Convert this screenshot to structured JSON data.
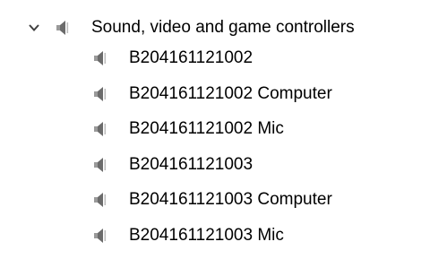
{
  "category": {
    "label": "Sound, video and game controllers",
    "expanded": true,
    "icon": "speaker-icon",
    "expand_icon": "chevron-down-icon"
  },
  "devices": [
    {
      "label": "B204161121002",
      "icon": "speaker-icon"
    },
    {
      "label": "B204161121002 Computer",
      "icon": "speaker-icon"
    },
    {
      "label": "B204161121002 Mic",
      "icon": "speaker-icon"
    },
    {
      "label": "B204161121003",
      "icon": "speaker-icon"
    },
    {
      "label": "B204161121003 Computer",
      "icon": "speaker-icon"
    },
    {
      "label": "B204161121003 Mic",
      "icon": "speaker-icon"
    }
  ],
  "colors": {
    "text": "#000000",
    "icon_dark": "#6b6b6b",
    "icon_light": "#bdbdbd",
    "chevron": "#404040"
  }
}
